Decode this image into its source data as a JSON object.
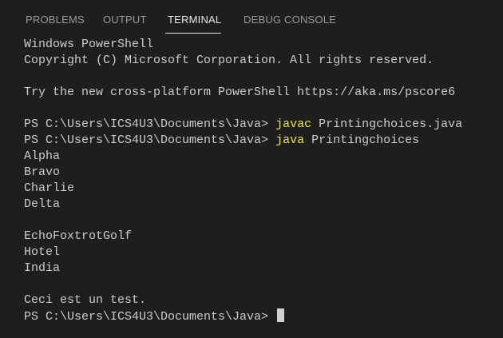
{
  "tabs": [
    {
      "label": "PROBLEMS",
      "active": false
    },
    {
      "label": "OUTPUT",
      "active": false
    },
    {
      "label": "TERMINAL",
      "active": true
    },
    {
      "label": "DEBUG CONSOLE",
      "active": false
    }
  ],
  "terminal": {
    "lines": [
      {
        "text": "Windows PowerShell"
      },
      {
        "text": "Copyright (C) Microsoft Corporation. All rights reserved."
      },
      {
        "text": ""
      },
      {
        "text": "Try the new cross-platform PowerShell https://aka.ms/pscore6"
      },
      {
        "text": ""
      },
      {
        "prompt": "PS C:\\Users\\ICS4U3\\Documents\\Java> ",
        "command": "javac",
        "args": " Printingchoices.java"
      },
      {
        "prompt": "PS C:\\Users\\ICS4U3\\Documents\\Java> ",
        "command": "java",
        "args": " Printingchoices"
      },
      {
        "text": "Alpha"
      },
      {
        "text": "Bravo"
      },
      {
        "text": "Charlie"
      },
      {
        "text": "Delta"
      },
      {
        "text": ""
      },
      {
        "text": "EchoFoxtrotGolf"
      },
      {
        "text": "Hotel"
      },
      {
        "text": "India"
      },
      {
        "text": ""
      },
      {
        "text": "Ceci est un test."
      }
    ],
    "current_prompt": "PS C:\\Users\\ICS4U3\\Documents\\Java> "
  },
  "colors": {
    "background": "#1e1e1e",
    "text": "#cccccc",
    "command": "#e8e84a",
    "active_tab": "#e7e7e7",
    "inactive_tab": "#9a9a9a"
  }
}
